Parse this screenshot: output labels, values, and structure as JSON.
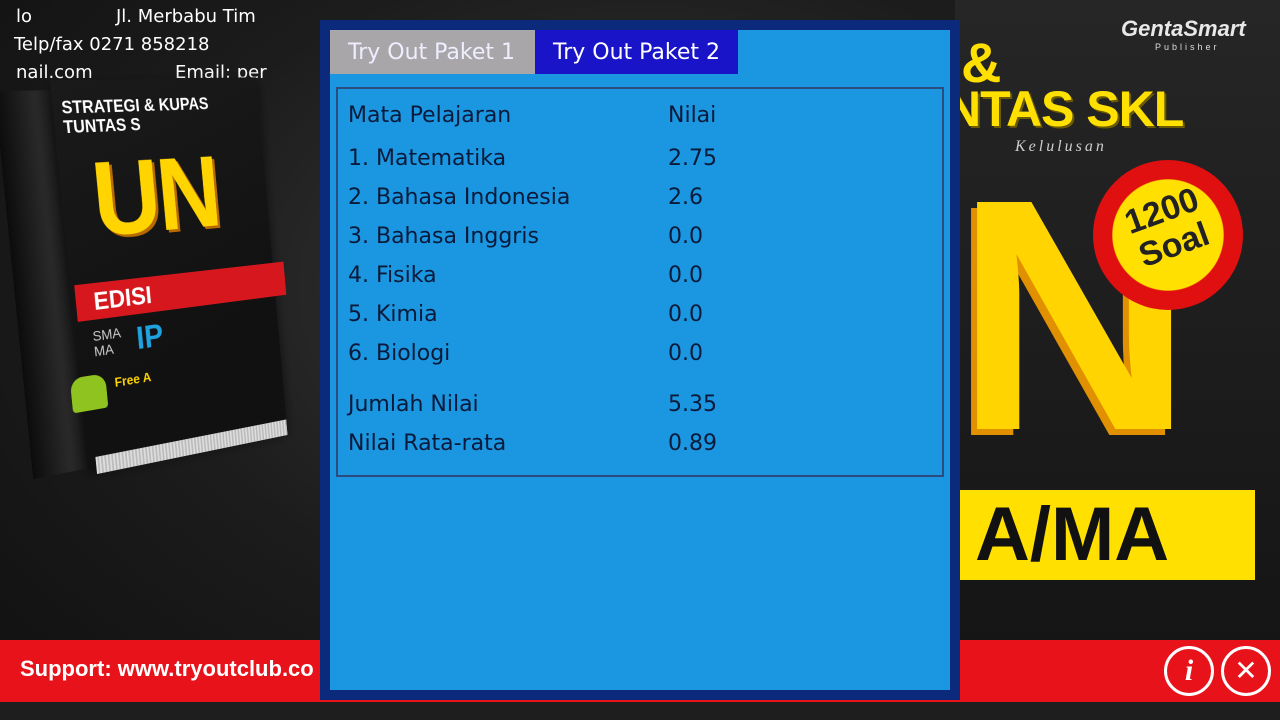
{
  "background": {
    "contact_line1_left": "lo",
    "contact_line1_right": "Jl. Merbabu Tim",
    "contact_line2": "Telp/fax 0271 858218",
    "contact_line3_left": "nail.com",
    "contact_line3_right": "Email: per",
    "left_book": {
      "title": "STRATEGI & KUPAS TUNTAS S",
      "un": "UN",
      "edisi": "EDISI",
      "sma": "SMA MA",
      "ipa": "IP",
      "free": "Free A"
    },
    "right_book": {
      "amp": "&",
      "skl": "NTAS SKL",
      "kelulusan": "Kelulusan",
      "n": "N",
      "badge": "1200 Soal",
      "ribbon": "A/MA",
      "logo": "GentaSmart",
      "logo_sub": "Publisher"
    }
  },
  "support": {
    "text": "Support: www.tryoutclub.co",
    "info_icon": "info-icon",
    "close_icon": "close-icon"
  },
  "dialog": {
    "tabs": [
      "Try Out Paket 1",
      "Try Out Paket 2"
    ],
    "active_tab": 1,
    "header": {
      "subject": "Mata Pelajaran",
      "score": "Nilai"
    },
    "rows": [
      {
        "subject": "1. Matematika",
        "score": "2.75"
      },
      {
        "subject": "2. Bahasa Indonesia",
        "score": "2.6"
      },
      {
        "subject": "3. Bahasa Inggris",
        "score": "0.0"
      },
      {
        "subject": "4. Fisika",
        "score": "0.0"
      },
      {
        "subject": "5. Kimia",
        "score": "0.0"
      },
      {
        "subject": "6. Biologi",
        "score": "0.0"
      }
    ],
    "total": {
      "label": "Jumlah Nilai",
      "value": "5.35"
    },
    "average": {
      "label": "Nilai Rata-rata",
      "value": "0.89"
    }
  },
  "colors": {
    "dialog_border": "#0b2a7c",
    "dialog_bg": "#1a97e0",
    "tab_inactive": "#a8a6a8",
    "tab_active": "#1a14c8",
    "support_bar": "#e8121a"
  }
}
